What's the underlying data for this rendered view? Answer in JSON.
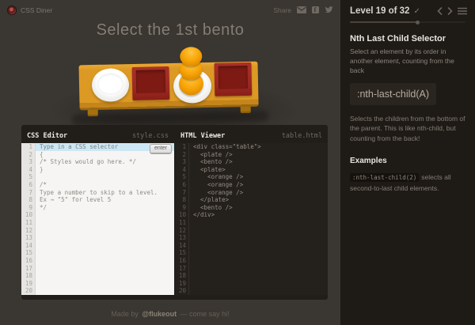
{
  "app": {
    "logo_text": "CSS Diner",
    "share_label": "Share",
    "share_icons": [
      "email-icon",
      "facebook-icon",
      "twitter-icon"
    ]
  },
  "header": {
    "title": "Select the 1st bento"
  },
  "scene": {
    "items": [
      {
        "type": "plate"
      },
      {
        "type": "bento"
      },
      {
        "type": "plate",
        "children": [
          "orange",
          "orange",
          "orange"
        ]
      },
      {
        "type": "bento"
      }
    ]
  },
  "css_editor": {
    "title": "CSS Editor",
    "filename": "style.css",
    "enter_label": "enter",
    "placeholder": "Type in a CSS selector",
    "lines": [
      "Type in a CSS selector",
      "{",
      "/* Styles would go here. */",
      "}",
      "",
      "/*",
      "Type a number to skip to a level.",
      "Ex → \"5\" for level 5",
      "*/",
      "",
      "",
      "",
      "",
      "",
      "",
      "",
      "",
      "",
      "",
      ""
    ]
  },
  "html_viewer": {
    "title": "HTML Viewer",
    "filename": "table.html",
    "lines": [
      "<div class=\"table\">",
      "  <plate />",
      "  <bento />",
      "  <plate>",
      "    <orange />",
      "    <orange />",
      "    <orange />",
      "  </plate>",
      "  <bento />",
      "</div>",
      "",
      "",
      "",
      "",
      "",
      "",
      "",
      "",
      "",
      ""
    ]
  },
  "footer": {
    "made_by": "Made by",
    "author": "@flukeout",
    "suffix": "— come say hi!"
  },
  "sidebar": {
    "level_label": "Level 19 of 32",
    "check_icon": "✓",
    "progress_percent": 59,
    "lesson": {
      "title": "Nth Last Child Selector",
      "subtitle": "Select an element by its order in another element, counting from the back",
      "syntax": ":nth-last-child(A)",
      "description": "Selects the children from the bottom of the parent. This is like nth-child, but counting from the back!",
      "examples_title": "Examples",
      "examples": [
        {
          "code": ":nth-last-child(2)",
          "text": "selects all second-to-last child elements."
        }
      ]
    }
  },
  "colors": {
    "main_bg": "#3a3631",
    "sidebar_bg": "#1e1a16",
    "table_orange": "#dc9a24",
    "bento_red": "#9d2a22",
    "orange_fruit": "#f59e00",
    "editor_highlight": "#cde7f4",
    "logo_red": "#9c3a34"
  }
}
